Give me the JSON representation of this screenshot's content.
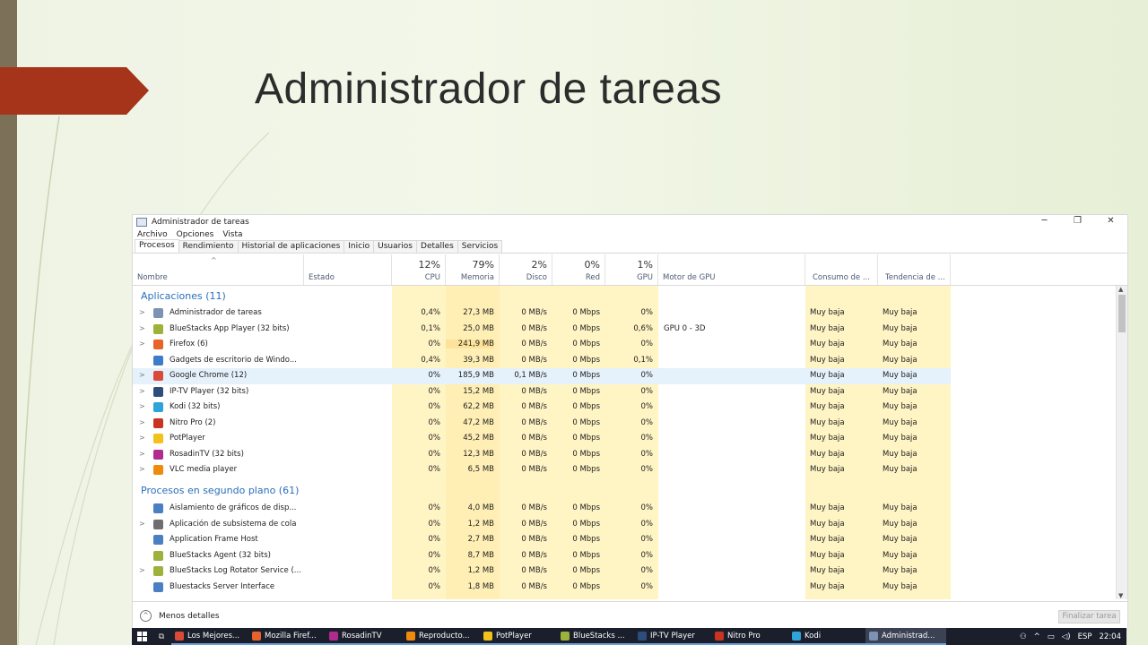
{
  "slide": {
    "title": "Administrador de tareas"
  },
  "window": {
    "title": "Administrador de tareas",
    "minimize": "─",
    "restore": "❐",
    "close": "✕",
    "menu": [
      "Archivo",
      "Opciones",
      "Vista"
    ],
    "tabs": [
      "Procesos",
      "Rendimiento",
      "Historial de aplicaciones",
      "Inicio",
      "Usuarios",
      "Detalles",
      "Servicios"
    ],
    "columns": {
      "nombre": "Nombre",
      "estado": "Estado",
      "cpu_pct": "12%",
      "cpu": "CPU",
      "mem_pct": "79%",
      "mem": "Memoria",
      "disk_pct": "2%",
      "disk": "Disco",
      "net_pct": "0%",
      "net": "Red",
      "gpu_pct": "1%",
      "gpu": "GPU",
      "gpu_engine": "Motor de GPU",
      "power": "Consumo de ...",
      "power_trend": "Tendencia de ..."
    },
    "groups": {
      "apps": "Aplicaciones (11)",
      "background": "Procesos en segundo plano (61)"
    },
    "apps": [
      {
        "name": "Administrador de tareas",
        "cpu": "0,4%",
        "mem": "27,3 MB",
        "disk": "0 MB/s",
        "net": "0 Mbps",
        "gpu": "0%",
        "engine": "",
        "power": "Muy baja",
        "trend": "Muy baja",
        "icon": "task-manager-icon",
        "color": "#7c93b3",
        "exp": true
      },
      {
        "name": "BlueStacks App Player (32 bits)",
        "cpu": "0,1%",
        "mem": "25,0 MB",
        "disk": "0 MB/s",
        "net": "0 Mbps",
        "gpu": "0,6%",
        "engine": "GPU 0 - 3D",
        "power": "Muy baja",
        "trend": "Muy baja",
        "icon": "bluestacks-icon",
        "color": "#9cb23a",
        "exp": true
      },
      {
        "name": "Firefox (6)",
        "cpu": "0%",
        "mem": "241,9 MB",
        "disk": "0 MB/s",
        "net": "0 Mbps",
        "gpu": "0%",
        "engine": "",
        "power": "Muy baja",
        "trend": "Muy baja",
        "icon": "firefox-icon",
        "color": "#e8622a",
        "exp": true
      },
      {
        "name": "Gadgets de escritorio de Windo...",
        "cpu": "0,4%",
        "mem": "39,3 MB",
        "disk": "0 MB/s",
        "net": "0 Mbps",
        "gpu": "0,1%",
        "engine": "",
        "power": "Muy baja",
        "trend": "Muy baja",
        "icon": "gadgets-icon",
        "color": "#3d7cc9",
        "exp": false
      },
      {
        "name": "Google Chrome (12)",
        "cpu": "0%",
        "mem": "185,9 MB",
        "disk": "0,1 MB/s",
        "net": "0 Mbps",
        "gpu": "0%",
        "engine": "",
        "power": "Muy baja",
        "trend": "Muy baja",
        "icon": "chrome-icon",
        "color": "#d94a38",
        "exp": true
      },
      {
        "name": "IP-TV Player (32 bits)",
        "cpu": "0%",
        "mem": "15,2 MB",
        "disk": "0 MB/s",
        "net": "0 Mbps",
        "gpu": "0%",
        "engine": "",
        "power": "Muy baja",
        "trend": "Muy baja",
        "icon": "iptv-icon",
        "color": "#2d4d7a",
        "exp": true
      },
      {
        "name": "Kodi (32 bits)",
        "cpu": "0%",
        "mem": "62,2 MB",
        "disk": "0 MB/s",
        "net": "0 Mbps",
        "gpu": "0%",
        "engine": "",
        "power": "Muy baja",
        "trend": "Muy baja",
        "icon": "kodi-icon",
        "color": "#2fa4d9",
        "exp": true
      },
      {
        "name": "Nitro Pro (2)",
        "cpu": "0%",
        "mem": "47,2 MB",
        "disk": "0 MB/s",
        "net": "0 Mbps",
        "gpu": "0%",
        "engine": "",
        "power": "Muy baja",
        "trend": "Muy baja",
        "icon": "nitro-icon",
        "color": "#c8341f",
        "exp": true
      },
      {
        "name": "PotPlayer",
        "cpu": "0%",
        "mem": "45,2 MB",
        "disk": "0 MB/s",
        "net": "0 Mbps",
        "gpu": "0%",
        "engine": "",
        "power": "Muy baja",
        "trend": "Muy baja",
        "icon": "potplayer-icon",
        "color": "#f2c21a",
        "exp": true
      },
      {
        "name": "RosadinTV (32 bits)",
        "cpu": "0%",
        "mem": "12,3 MB",
        "disk": "0 MB/s",
        "net": "0 Mbps",
        "gpu": "0%",
        "engine": "",
        "power": "Muy baja",
        "trend": "Muy baja",
        "icon": "rosadintv-icon",
        "color": "#b02a8f",
        "exp": true
      },
      {
        "name": "VLC media player",
        "cpu": "0%",
        "mem": "6,5 MB",
        "disk": "0 MB/s",
        "net": "0 Mbps",
        "gpu": "0%",
        "engine": "",
        "power": "Muy baja",
        "trend": "Muy baja",
        "icon": "vlc-icon",
        "color": "#f08a0c",
        "exp": true
      }
    ],
    "background": [
      {
        "name": "Aislamiento de gráficos de disp...",
        "cpu": "0%",
        "mem": "4,0 MB",
        "disk": "0 MB/s",
        "net": "0 Mbps",
        "gpu": "0%",
        "engine": "",
        "power": "Muy baja",
        "trend": "Muy baja",
        "icon": "service-icon",
        "color": "#4a7fc1",
        "exp": false
      },
      {
        "name": "Aplicación de subsistema de cola",
        "cpu": "0%",
        "mem": "1,2 MB",
        "disk": "0 MB/s",
        "net": "0 Mbps",
        "gpu": "0%",
        "engine": "",
        "power": "Muy baja",
        "trend": "Muy baja",
        "icon": "printer-icon",
        "color": "#6e6e6e",
        "exp": true
      },
      {
        "name": "Application Frame Host",
        "cpu": "0%",
        "mem": "2,7 MB",
        "disk": "0 MB/s",
        "net": "0 Mbps",
        "gpu": "0%",
        "engine": "",
        "power": "Muy baja",
        "trend": "Muy baja",
        "icon": "service-icon",
        "color": "#4a7fc1",
        "exp": false
      },
      {
        "name": "BlueStacks Agent (32 bits)",
        "cpu": "0%",
        "mem": "8,7 MB",
        "disk": "0 MB/s",
        "net": "0 Mbps",
        "gpu": "0%",
        "engine": "",
        "power": "Muy baja",
        "trend": "Muy baja",
        "icon": "bluestacks-icon",
        "color": "#9cb23a",
        "exp": false
      },
      {
        "name": "BlueStacks Log Rotator Service (...",
        "cpu": "0%",
        "mem": "1,2 MB",
        "disk": "0 MB/s",
        "net": "0 Mbps",
        "gpu": "0%",
        "engine": "",
        "power": "Muy baja",
        "trend": "Muy baja",
        "icon": "bluestacks-icon",
        "color": "#9cb23a",
        "exp": true
      },
      {
        "name": "Bluestacks Server Interface",
        "cpu": "0%",
        "mem": "1,8 MB",
        "disk": "0 MB/s",
        "net": "0 Mbps",
        "gpu": "0%",
        "engine": "",
        "power": "Muy baja",
        "trend": "Muy baja",
        "icon": "service-icon",
        "color": "#4a7fc1",
        "exp": false
      }
    ],
    "footer": {
      "less": "Menos detalles",
      "end_task": "Finalizar tarea"
    }
  },
  "taskbar": {
    "items": [
      {
        "label": "Los Mejores...",
        "icon": "chrome-icon",
        "color": "#d94a38"
      },
      {
        "label": "Mozilla Firef...",
        "icon": "firefox-icon",
        "color": "#e8622a"
      },
      {
        "label": "RosadinTV",
        "icon": "rosadintv-icon",
        "color": "#b02a8f"
      },
      {
        "label": "Reproducto...",
        "icon": "vlc-icon",
        "color": "#f08a0c"
      },
      {
        "label": "PotPlayer",
        "icon": "potplayer-icon",
        "color": "#f2c21a"
      },
      {
        "label": "BlueStacks ...",
        "icon": "bluestacks-icon",
        "color": "#9cb23a"
      },
      {
        "label": "IP-TV Player",
        "icon": "iptv-icon",
        "color": "#2d4d7a"
      },
      {
        "label": "Nitro Pro",
        "icon": "nitro-icon",
        "color": "#c8341f"
      },
      {
        "label": "Kodi",
        "icon": "kodi-icon",
        "color": "#2fa4d9"
      },
      {
        "label": "Administrad...",
        "icon": "task-manager-icon",
        "color": "#7c93b3"
      }
    ],
    "lang": "ESP",
    "time": "22:04"
  },
  "colors": {
    "heat_light": "#fff4c4",
    "heat_medium": "#ffe9a8",
    "heat_strong": "#fde39a",
    "accent_blue": "#2a6ebb",
    "ribbon": "#a6341a"
  }
}
